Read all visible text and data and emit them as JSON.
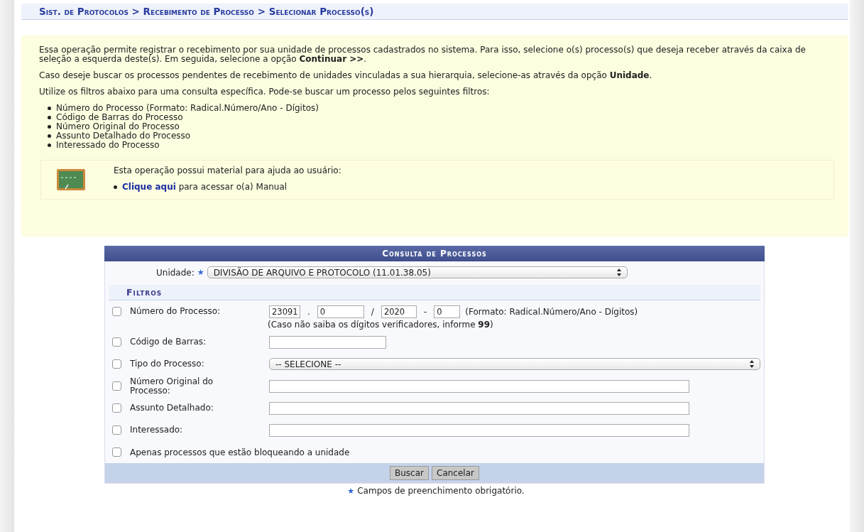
{
  "breadcrumb": "Sist. de Protocolos > Recebimento de Processo > Selecionar Processo(s)",
  "intro": {
    "paragraphs": [
      "Essa operação permite registrar o recebimento por sua unidade de processos cadastrados no sistema. Para isso, selecione o(s) processo(s) que deseja receber através da caixa de seleção a esquerda deste(s). Em seguida, selecione a opção **Continuar >>**.",
      "Caso deseje buscar os processos pendentes de recebimento de unidades vinculadas a sua hierarquia, selecione-as através da opção **Unidade**.",
      "Utilize os filtros abaixo para uma consulta específica. Pode-se buscar um processo pelos seguintes filtros:"
    ],
    "filters": [
      "Número do Processo (Formato: Radical.Número/Ano - Dígitos)",
      "Código de Barras do Processo",
      "Número Original do Processo",
      "Assunto Detalhado do Processo",
      "Interessado do Processo"
    ],
    "help": {
      "text": "Esta operação possui material para ajuda ao usuário:",
      "link": "Clique aqui",
      "rest": " para acessar o(a) Manual"
    }
  },
  "form": {
    "title": "Consulta de Processos",
    "required_mark": "★",
    "unidade": {
      "label": "Unidade:",
      "value": "DIVISÃO DE ARQUIVO E PROTOCOLO (11.01.38.05)"
    },
    "section": "Filtros",
    "rows": [
      {
        "kind": "numero",
        "label": "Número do Processo:",
        "checked": false,
        "parts": [
          {
            "kind": "input",
            "value": "23091"
          },
          {
            "kind": "sep",
            "text": "."
          },
          {
            "kind": "input",
            "value": "0"
          },
          {
            "kind": "sep",
            "text": "/"
          },
          {
            "kind": "input",
            "value": "2020"
          },
          {
            "kind": "sep",
            "text": "-"
          },
          {
            "kind": "input",
            "value": "0"
          }
        ],
        "format": "(Formato: Radical.Número/Ano - Dígitos)",
        "hint": "(Caso não saiba os dígitos verificadores, informe **99**)"
      },
      {
        "kind": "short_text",
        "label": "Código de Barras:",
        "checked": false
      },
      {
        "kind": "select",
        "label": "Tipo do Processo:",
        "checked": false,
        "value": "-- SELECIONE --"
      },
      {
        "kind": "text",
        "label": "Número Original do Processo:",
        "checked": false
      },
      {
        "kind": "text",
        "label": "Assunto Detalhado:",
        "checked": false
      },
      {
        "kind": "text",
        "label": "Interessado:",
        "checked": false
      },
      {
        "kind": "check",
        "label": "Apenas processos que estão bloqueando a unidade",
        "checked": false
      }
    ],
    "buttons": [
      "Buscar",
      "Cancelar"
    ],
    "footnote": "Campos de preenchimento obrigatório."
  }
}
